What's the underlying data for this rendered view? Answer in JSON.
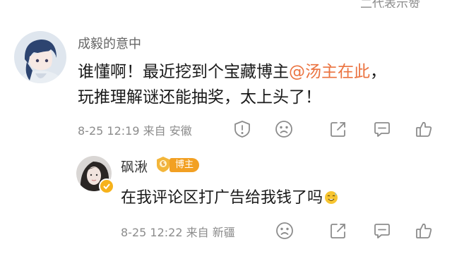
{
  "top_partial_text": "二代表示赞",
  "comments": [
    {
      "username": "成毅的意中",
      "text_before": "谁懂啊！最近挖到个宝藏博主",
      "mention": "@汤主在此",
      "text_after": "，",
      "text_line2": "玩推理解谜还能抽奖，太上头了！",
      "date": "8-25 12:19",
      "location": "来自 安徽"
    },
    {
      "username": "砜湫",
      "badge": "博主",
      "text": "在我评论区打广告给我钱了吗",
      "date": "8-25 12:22",
      "location": "来自 新疆"
    }
  ],
  "icons": {
    "report": "report-icon",
    "dislike": "sad-face-icon",
    "share": "share-icon",
    "comment": "comment-icon",
    "like": "thumbs-up-icon"
  },
  "colors": {
    "mention": "#eb7340",
    "badge": "#f2a023"
  }
}
